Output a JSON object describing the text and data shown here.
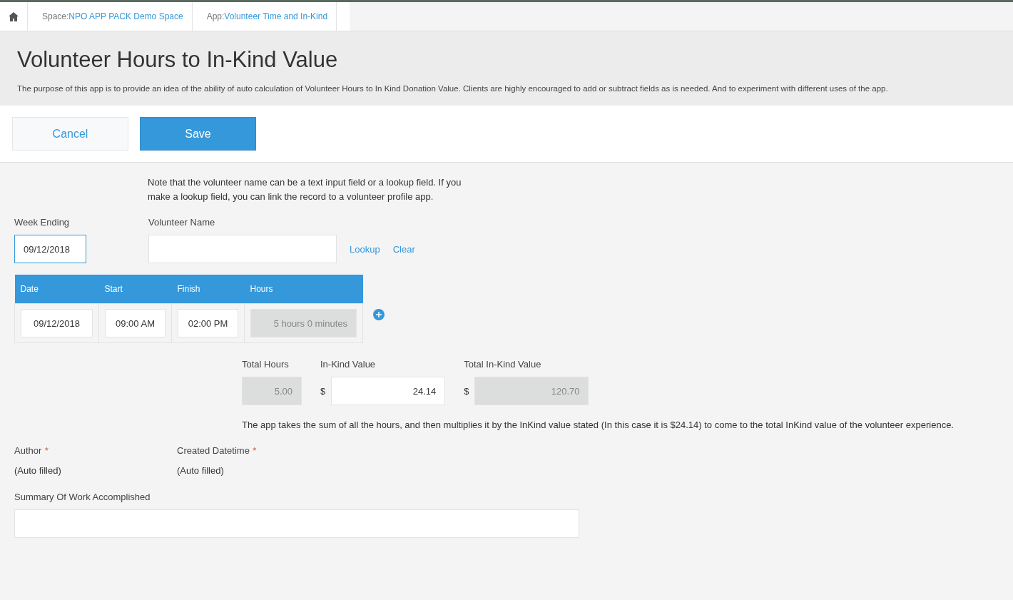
{
  "breadcrumb": [
    {
      "prefix": "Space: ",
      "link": "NPO APP PACK Demo Space"
    },
    {
      "prefix": "App: ",
      "link": "Volunteer Time and In-Kind"
    }
  ],
  "title": "Volunteer Hours to In-Kind Value",
  "description": "The purpose of this app is to provide an idea of the ability of auto calculation of Volunteer Hours to In Kind Donation Value. Clients are highly encouraged to add or subtract fields as is needed. And to experiment with different uses of the app.",
  "buttons": {
    "cancel": "Cancel",
    "save": "Save"
  },
  "note": "Note that the volunteer name can be a text input field or a lookup field. If you make a lookup field, you can link the record to a volunteer profile app.",
  "week_ending": {
    "label": "Week Ending",
    "value": "09/12/2018",
    "focused": true
  },
  "volunteer_name": {
    "label": "Volunteer Name",
    "lookup": "Lookup",
    "clear": "Clear"
  },
  "table": {
    "columns": [
      "Date",
      "Start",
      "Finish",
      "Hours"
    ],
    "rows": [
      [
        {
          "value": "09/12/2018",
          "readonly": false
        },
        {
          "value": "09:00 AM",
          "readonly": false
        },
        {
          "value": "02:00 PM",
          "readonly": false
        },
        {
          "value": "5 hours 0 minutes",
          "readonly": true
        }
      ]
    ]
  },
  "totals": [
    {
      "label": "Total Hours",
      "value": "5.00",
      "readonly": true
    },
    {
      "label": "In-Kind Value",
      "prefix": "$",
      "value": "24.14",
      "readonly": false
    },
    {
      "label": "Total In-Kind Value",
      "prefix": "$",
      "value": "120.70",
      "readonly": true
    }
  ],
  "explanation": "The app takes the sum of all the hours, and then multiplies it by the InKind value stated (In this case it is $24.14) to come to the total InKind value of the volunteer experience.",
  "auto_fields": [
    {
      "label": "Author",
      "marker": "*",
      "value": "(Auto filled)"
    },
    {
      "label": "Created Datetime",
      "marker": "*",
      "value": "(Auto filled)"
    }
  ],
  "summary": {
    "label": "Summary Of Work Accomplished"
  }
}
